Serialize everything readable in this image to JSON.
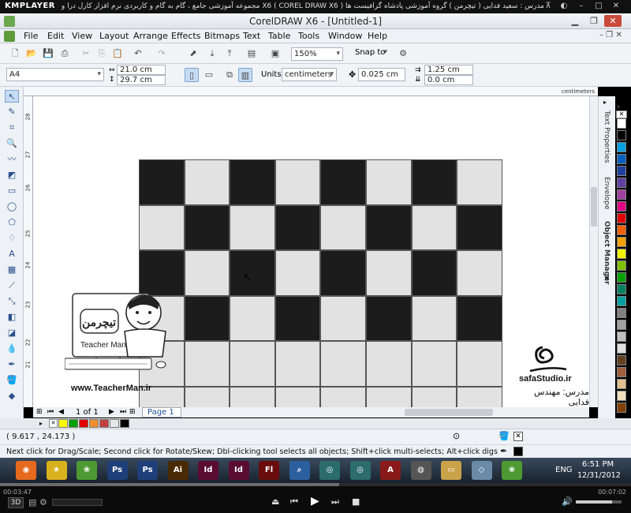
{
  "player": {
    "logo": "KMPLAYER",
    "title": "مجموعه آموزشی جامع ، گام به گام و کاربردی نرم افزار کارل درا و X6 ( COREL DRAW X6 )   مدرس : سعید فدایی ( تیچرمن ) گروه آموزشی پادشاه گرافیست ها",
    "time_elapsed": "00:03:47",
    "time_total": "00:07:02",
    "label_3d": "3D"
  },
  "window": {
    "title": "CorelDRAW X6 - [Untitled-1]"
  },
  "menu": [
    "File",
    "Edit",
    "View",
    "Layout",
    "Arrange",
    "Effects",
    "Bitmaps",
    "Text",
    "Table",
    "Tools",
    "Window",
    "Help"
  ],
  "standard_toolbar": {
    "zoom": "150%",
    "snap_to": "Snap to"
  },
  "property_bar": {
    "paper": "A4",
    "width": "21.0 cm",
    "height": "29.7 cm",
    "units_label": "Units:",
    "units": "centimeters",
    "nudge": "0.025 cm",
    "dup_x": "1.25 cm",
    "dup_y": "0.0 cm"
  },
  "ruler": {
    "top_units": "centimeters",
    "left_units": "centimeters",
    "left_ticks": [
      "28",
      "27",
      "26",
      "25",
      "24",
      "23",
      "22",
      "21"
    ]
  },
  "dockers": {
    "tabs": [
      "Text Properties",
      "Envelope",
      "Object Manager"
    ]
  },
  "page_nav": {
    "counter": "1 of 1",
    "page_tab": "Page 1"
  },
  "status": {
    "coords": "( 9.617 , 24.173 )",
    "hint": "Next click for Drag/Scale; Second click for Rotate/Skew; Dbl-clicking tool selects all objects; Shift+click multi-selects; Alt+click digs"
  },
  "watermark": {
    "teacherman_logo": "تیچرمن",
    "teacherman_en": "Teacher Man",
    "url": "www.TeacherMan.ir",
    "safa_url": "safaStudio.ir",
    "safa_credit": "مدرس: مهندس فدایی"
  },
  "taskbar": {
    "lang": "ENG",
    "time": "6:51 PM",
    "date": "12/31/2012",
    "apps": [
      "Firefox",
      "Stars",
      "CorelDRAW",
      "Photoshop",
      "Photoshop",
      "Illustrator",
      "InDesign",
      "InDesign",
      "Flash",
      "Navigator",
      "3ds Max",
      "3ds Max",
      "AutoCAD",
      "Media",
      "Explorer",
      "Paper",
      "CorelDRAW"
    ]
  },
  "colors": {
    "black_square": "#1c1c1c",
    "light_square": "#e2e2e2",
    "corel_green": "#6aa84f"
  },
  "palette": [
    "#ffffff",
    "#000000",
    "#00a0e0",
    "#0060c0",
    "#2040a0",
    "#6040a0",
    "#a040a0",
    "#e00080",
    "#e00000",
    "#f06000",
    "#f0a000",
    "#f0f000",
    "#80c000",
    "#00a000",
    "#008060",
    "#00a0a0",
    "#808080",
    "#a0a0a0",
    "#c0c0c0",
    "#e0e0e0",
    "#604020",
    "#a06040",
    "#e0c090",
    "#f0e0c0",
    "#804000"
  ],
  "doc_palette": [
    "#ffff00",
    "#00a000",
    "#e00000",
    "#f09030",
    "#c04040",
    "#e8e8e8",
    "#000000"
  ]
}
